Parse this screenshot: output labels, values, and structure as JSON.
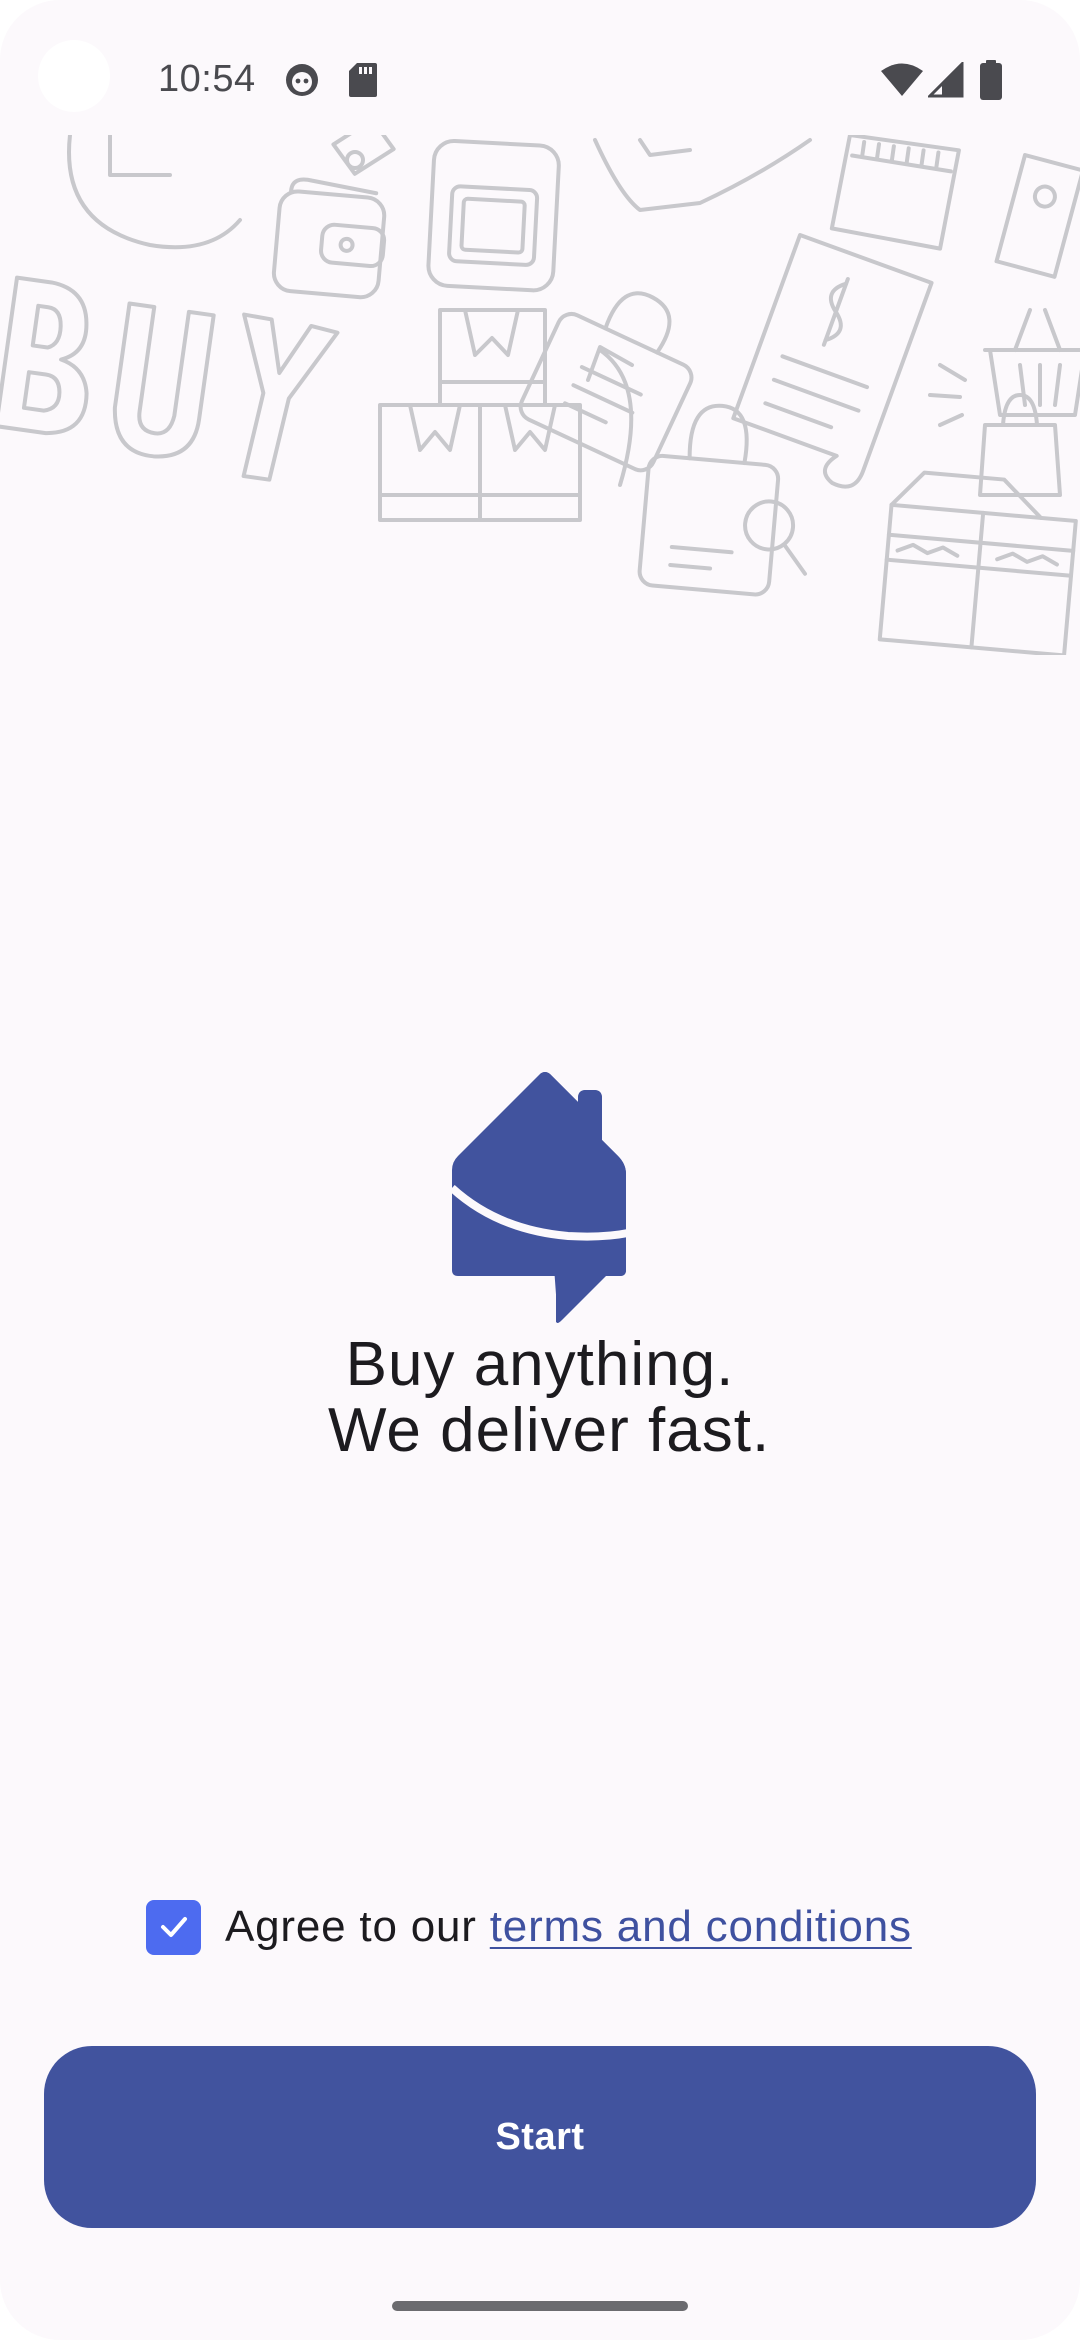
{
  "status_bar": {
    "time": "10:54",
    "left_icons": [
      "face-notification-icon",
      "sd-card-icon"
    ],
    "right_icons": [
      "wifi-icon",
      "cellular-signal-icon",
      "battery-icon"
    ]
  },
  "banner": {
    "doodle_text": "BUY"
  },
  "tagline": {
    "line1": "Buy anything.",
    "line2": " We deliver fast."
  },
  "agreement": {
    "checked": true,
    "prefix": "Agree to our ",
    "link_text": "terms and conditions"
  },
  "start_button": {
    "label": "Start"
  },
  "colors": {
    "brand": "#41539e",
    "checkbox": "#4d6bf0",
    "link": "#3f51a0",
    "background": "#fcf9fc",
    "doodle_stroke": "#c8c8cc"
  }
}
